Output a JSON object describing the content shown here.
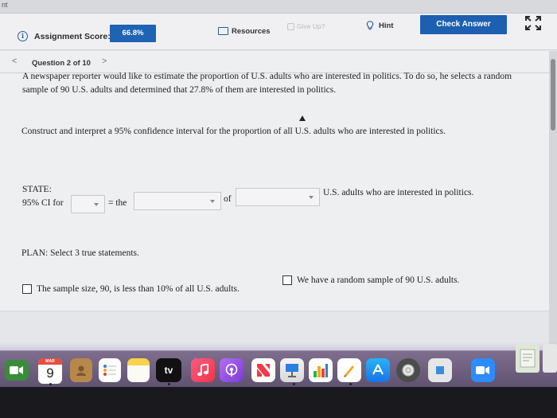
{
  "browser": {
    "tab_fragment": "nt"
  },
  "toolbar": {
    "score_label": "Assignment Score:",
    "score_value": "66.8%",
    "resources_label": "Resources",
    "give_up_label": "Give Up?",
    "hint_label": "Hint",
    "check_answer_label": "Check Answer"
  },
  "question_nav": {
    "prev_symbol": "<",
    "label": "Question 2 of 10",
    "next_symbol": ">"
  },
  "problem": {
    "text": "A newspaper reporter would like to estimate the proportion of U.S. adults who are interested in politics. To do so, he selects a random sample of 90 U.S. adults and determined that 27.8% of them are interested in politics.",
    "instruction": "Construct and interpret a 95% confidence interval for the proportion of all U.S. adults who are interested in politics."
  },
  "state": {
    "heading": "STATE:",
    "ci_label": "95% CI for",
    "equals_the": "= the",
    "of_label": "of",
    "trailing_text": "U.S. adults who are interested in politics.",
    "dropdown1_value": "",
    "dropdown2_value": "",
    "dropdown3_value": ""
  },
  "plan": {
    "heading": "PLAN: Select 3 true statements.",
    "options": [
      {
        "label": "The sample size, 90, is less than 10% of all U.S. adults.",
        "checked": false
      },
      {
        "label": "We have a random sample of 90 U.S. adults.",
        "checked": false
      }
    ]
  },
  "dock": {
    "calendar_month": "MAR",
    "calendar_day": "9",
    "tv_label": "tv"
  },
  "colors": {
    "accent": "#1d5fb0",
    "score_badge": "#1f63b5"
  }
}
